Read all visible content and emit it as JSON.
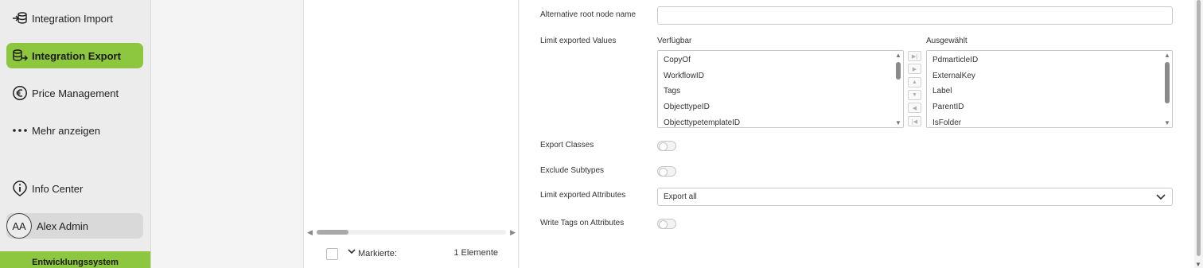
{
  "sidebar": {
    "items": [
      {
        "label": "Integration Import",
        "icon": "import-icon"
      },
      {
        "label": "Integration Export",
        "icon": "export-icon"
      },
      {
        "label": "Price Management",
        "icon": "euro-icon"
      },
      {
        "label": "Mehr anzeigen",
        "icon": "more-dots-icon"
      },
      {
        "label": "Info Center",
        "icon": "info-icon"
      }
    ],
    "user": {
      "initials": "AA",
      "name": "Alex Admin"
    },
    "environment": "Entwicklungssystem",
    "accent_color": "#8dc63f"
  },
  "tree": {
    "marked_label": "Markierte:",
    "marked_count": "1 Elemente"
  },
  "form": {
    "root_node_label": "Alternative root node name",
    "root_node_value": "",
    "limit_values_label": "Limit exported Values",
    "available_label": "Verfügbar",
    "selected_label": "Ausgewählt",
    "available_items": [
      "CopyOf",
      "WorkflowID",
      "Tags",
      "ObjecttypeID",
      "ObjecttypetemplateID"
    ],
    "selected_items": [
      "PdmarticleID",
      "ExternalKey",
      "Label",
      "ParentID",
      "IsFolder"
    ],
    "export_classes_label": "Export Classes",
    "export_classes_value": false,
    "exclude_subtypes_label": "Exclude Subtypes",
    "exclude_subtypes_value": false,
    "limit_attributes_label": "Limit exported Attributes",
    "limit_attributes_value": "Export all",
    "write_tags_label": "Write Tags on Attributes",
    "write_tags_value": false
  }
}
